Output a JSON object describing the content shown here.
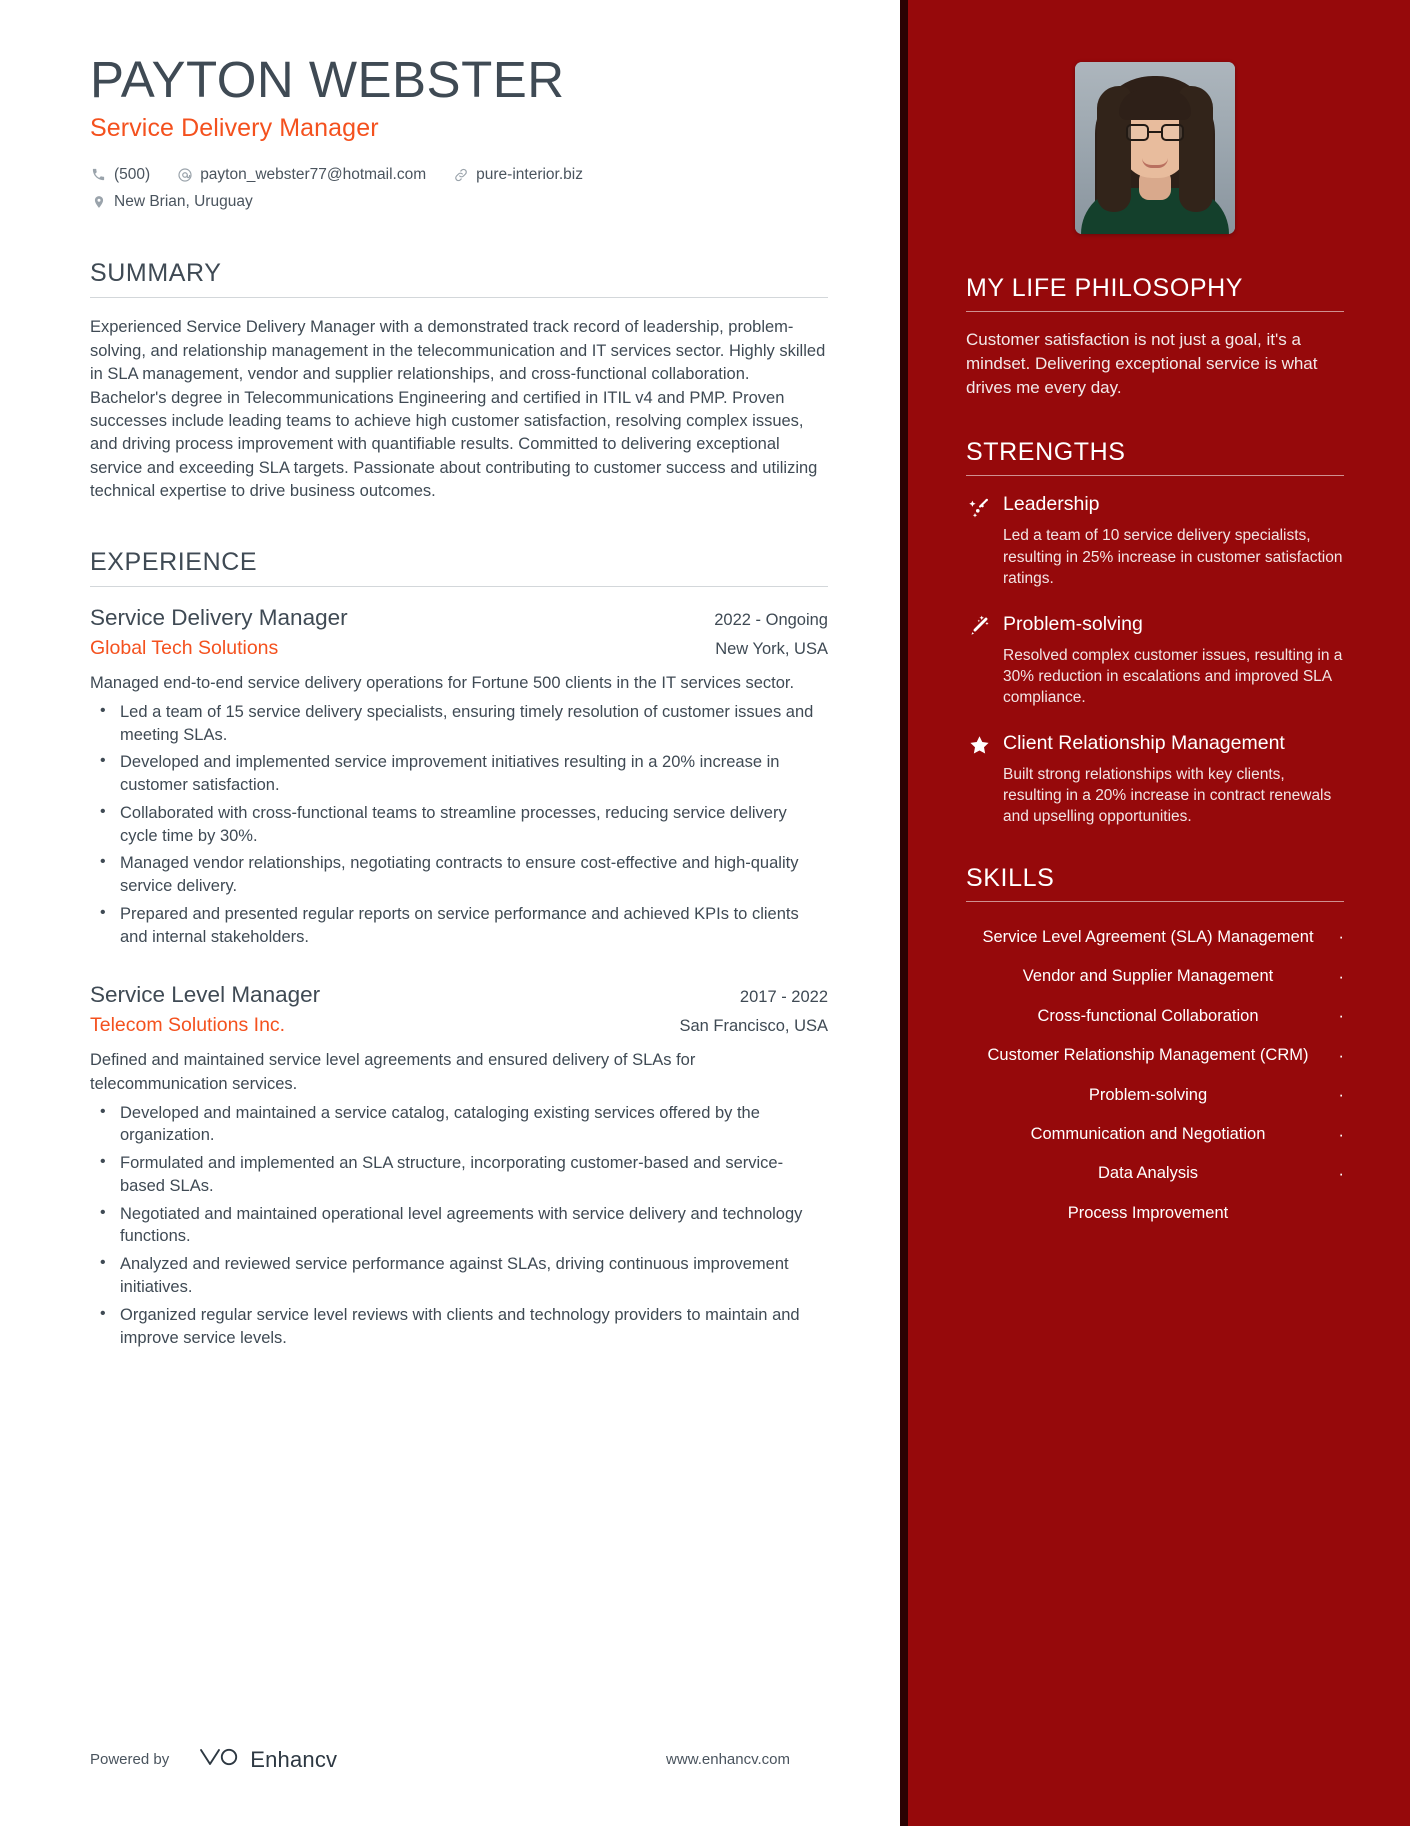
{
  "header": {
    "name": "PAYTON WEBSTER",
    "title": "Service Delivery Manager",
    "contacts": [
      {
        "icon": "phone-icon",
        "text": "(500)"
      },
      {
        "icon": "email-icon",
        "text": "payton_webster77@hotmail.com"
      },
      {
        "icon": "link-icon",
        "text": "pure-interior.biz"
      },
      {
        "icon": "location-pin-icon",
        "text": "New Brian, Uruguay"
      }
    ]
  },
  "summary": {
    "heading": "SUMMARY",
    "text": "Experienced Service Delivery Manager with a demonstrated track record of leadership, problem-solving, and relationship management in the telecommunication and IT services sector. Highly skilled in SLA management, vendor and supplier relationships, and cross-functional collaboration. Bachelor's degree in Telecommunications Engineering and certified in ITIL v4 and PMP. Proven successes include leading teams to achieve high customer satisfaction, resolving complex issues, and driving process improvement with quantifiable results. Committed to delivering exceptional service and exceeding SLA targets. Passionate about contributing to customer success and utilizing technical expertise to drive business outcomes."
  },
  "experience": {
    "heading": "EXPERIENCE",
    "jobs": [
      {
        "role": "Service Delivery Manager",
        "dates": "2022 - Ongoing",
        "company": "Global Tech Solutions",
        "location": "New York, USA",
        "description": "Managed end-to-end service delivery operations for Fortune 500 clients in the IT services sector.",
        "bullets": [
          "Led a team of 15 service delivery specialists, ensuring timely resolution of customer issues and meeting SLAs.",
          "Developed and implemented service improvement initiatives resulting in a 20% increase in customer satisfaction.",
          "Collaborated with cross-functional teams to streamline processes, reducing service delivery cycle time by 30%.",
          "Managed vendor relationships, negotiating contracts to ensure cost-effective and high-quality service delivery.",
          "Prepared and presented regular reports on service performance and achieved KPIs to clients and internal stakeholders."
        ]
      },
      {
        "role": "Service Level Manager",
        "dates": "2017 - 2022",
        "company": "Telecom Solutions Inc.",
        "location": "San Francisco, USA",
        "description": "Defined and maintained service level agreements and ensured delivery of SLAs for telecommunication services.",
        "bullets": [
          "Developed and maintained a service catalog, cataloging existing services offered by the organization.",
          "Formulated and implemented an SLA structure, incorporating customer-based and service-based SLAs.",
          "Negotiated and maintained operational level agreements with service delivery and technology functions.",
          "Analyzed and reviewed service performance against SLAs, driving continuous improvement initiatives.",
          "Organized regular service level reviews with clients and technology providers to maintain and improve service levels."
        ]
      }
    ]
  },
  "sidebar": {
    "philosophy": {
      "heading": "MY LIFE PHILOSOPHY",
      "text": "Customer satisfaction is not just a goal, it's a mindset. Delivering exceptional service is what drives me every day."
    },
    "strengths": {
      "heading": "STRENGTHS",
      "items": [
        {
          "icon": "shooting-star-icon",
          "name": "Leadership",
          "desc": "Led a team of 10 service delivery specialists, resulting in 25% increase in customer satisfaction ratings."
        },
        {
          "icon": "magic-wand-icon",
          "name": "Problem-solving",
          "desc": "Resolved complex customer issues, resulting in a 30% reduction in escalations and improved SLA compliance."
        },
        {
          "icon": "star-icon",
          "name": "Client Relationship Management",
          "desc": "Built strong relationships with key clients, resulting in a 20% increase in contract renewals and upselling opportunities."
        }
      ]
    },
    "skills": {
      "heading": "SKILLS",
      "items": [
        "Service Level Agreement (SLA) Management",
        "Vendor and Supplier Management",
        "Cross-functional Collaboration",
        "Customer Relationship Management (CRM)",
        "Problem-solving",
        "Communication and Negotiation",
        "Data Analysis",
        "Process Improvement"
      ]
    }
  },
  "footer": {
    "powered_by": "Powered by",
    "brand": "Enhancv",
    "url": "www.enhancv.com"
  },
  "colors": {
    "accent_orange": "#f4511e",
    "sidebar_red": "#96090b",
    "sidebar_edge": "#2b0203",
    "text_dark": "#3f4a54"
  }
}
